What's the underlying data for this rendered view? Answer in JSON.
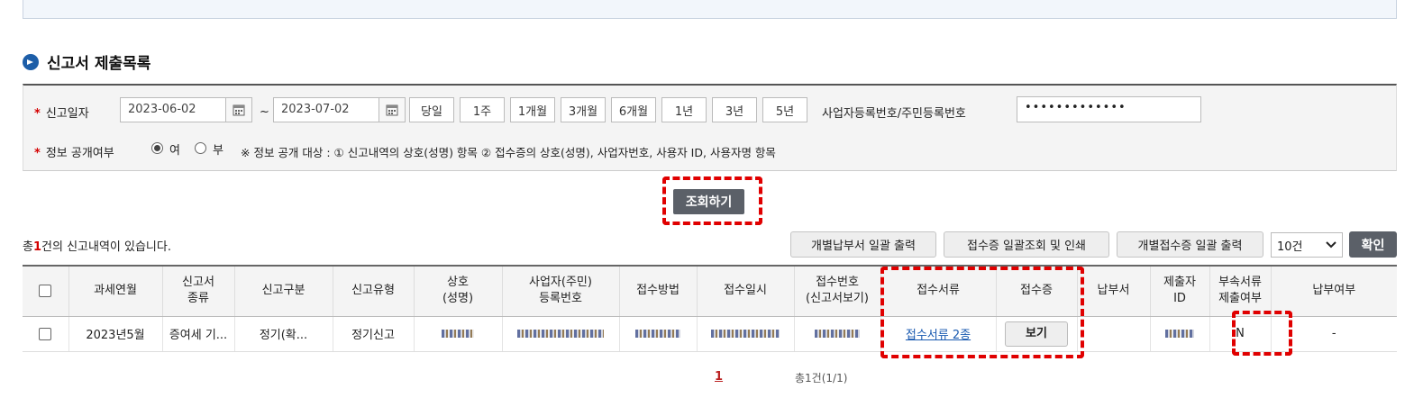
{
  "section": {
    "title": "신고서 제출목록"
  },
  "filter": {
    "date_label": "신고일자",
    "date_from": "2023-06-02",
    "date_to": "2023-07-02",
    "tilde": "~",
    "periods": [
      "당일",
      "1주",
      "1개월",
      "3개월",
      "6개월",
      "1년",
      "3년",
      "5년"
    ],
    "bizno_label": "사업자등록번호/주민등록번호",
    "bizno_value": "•••••••••••••",
    "public_label": "정보 공개여부",
    "radio_yes": "여",
    "radio_no": "부",
    "public_note": "※ 정보 공개 대상 : ① 신고내역의 상호(성명) 항목 ② 접수증의 상호(성명), 사업자번호, 사용자 ID, 사용자명 항목"
  },
  "search_label": "조회하기",
  "summary": {
    "prefix": "총",
    "count": "1",
    "suffix": "건의 신고내역이 있습니다."
  },
  "actions": {
    "btn1": "개별납부서 일괄 출력",
    "btn2": "접수증 일괄조회 및 인쇄",
    "btn3": "개별접수증 일괄 출력",
    "page_size": "10건",
    "confirm": "확인"
  },
  "table": {
    "headers": [
      "",
      "과세연월",
      "신고서\n종류",
      "신고구분",
      "신고유형",
      "상호\n(성명)",
      "사업자(주민)\n등록번호",
      "접수방법",
      "접수일시",
      "접수번호\n(신고서보기)",
      "접수서류",
      "접수증",
      "납부서",
      "제출자\nID",
      "부속서류\n제출여부",
      "납부여부"
    ],
    "row": {
      "tax_period": "2023년5월",
      "form_type": "증여세 기...",
      "report_kind": "정기(확...",
      "report_type": "정기신고",
      "docs_link": "접수서류 2종",
      "receipt_btn": "보기",
      "attach_yn": "N",
      "paid": "-"
    }
  },
  "pagination": {
    "current": "1",
    "total": "총1건(1/1)"
  },
  "colors": {
    "accent_red": "#e00000",
    "dark_button": "#5b6068",
    "title_icon": "#1d5ea8",
    "link": "#1a5ab0"
  }
}
